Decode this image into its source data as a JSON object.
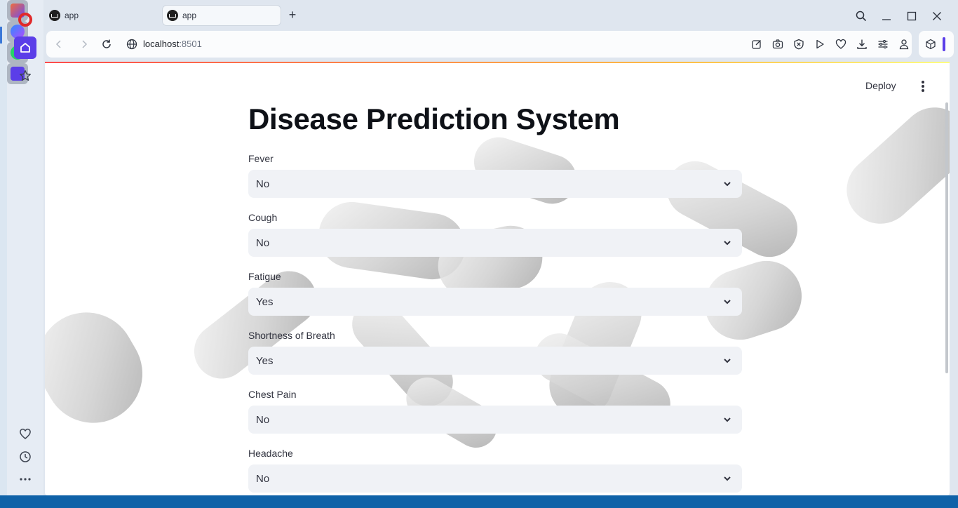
{
  "browser": {
    "tabs": [
      {
        "label": "app"
      },
      {
        "label": "app"
      }
    ],
    "address": {
      "host": "localhost",
      "port": ":8501"
    }
  },
  "app": {
    "deploy_label": "Deploy",
    "title": "Disease Prediction System",
    "fields": [
      {
        "label": "Fever",
        "value": "No"
      },
      {
        "label": "Cough",
        "value": "No"
      },
      {
        "label": "Fatigue",
        "value": "Yes"
      },
      {
        "label": "Shortness of Breath",
        "value": "Yes"
      },
      {
        "label": "Chest Pain",
        "value": "No"
      },
      {
        "label": "Headache",
        "value": "No"
      }
    ]
  },
  "colors": {
    "accent": "#5b3ee8",
    "streamlit_red": "#ff4b4b",
    "select_bg": "#f0f2f6",
    "text": "#31333f"
  }
}
